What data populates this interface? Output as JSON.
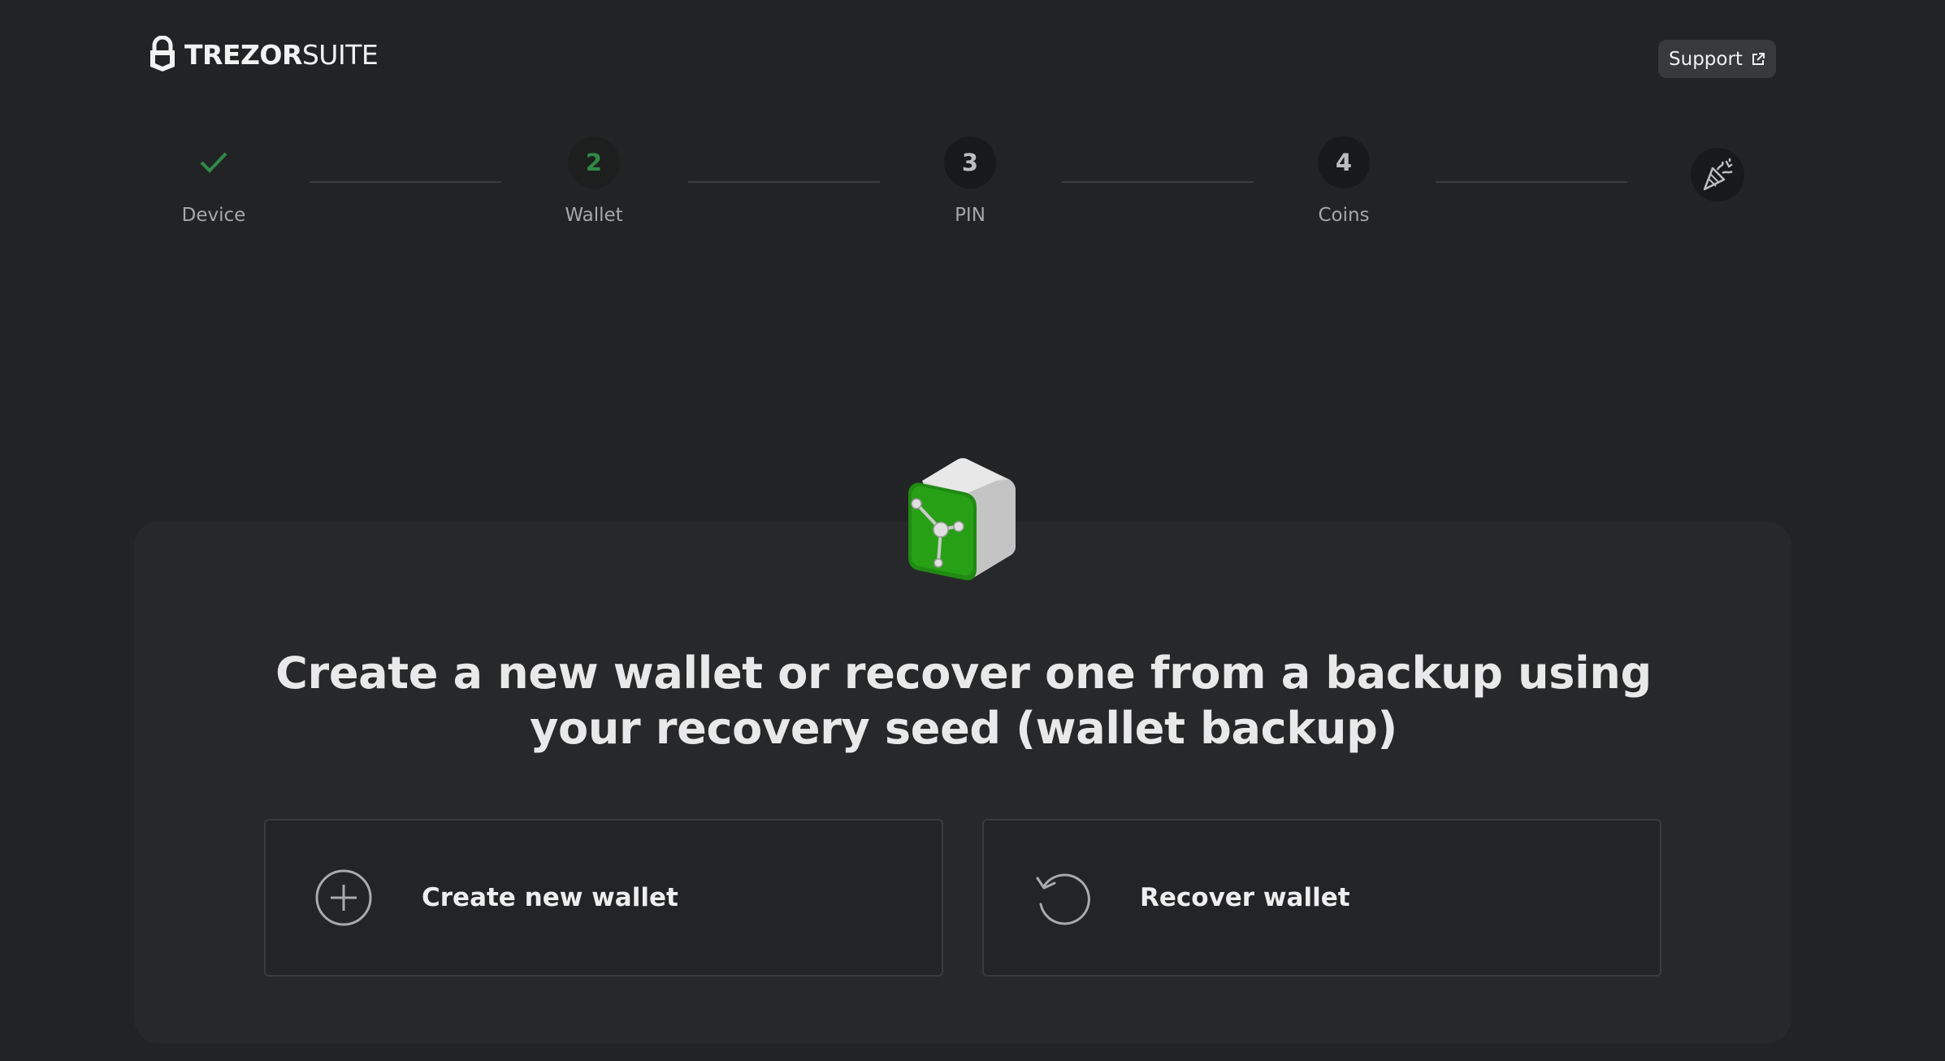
{
  "header": {
    "logo_bold": "TREZOR",
    "logo_light": "SUITE",
    "support_label": "Support"
  },
  "stepper": {
    "steps": [
      {
        "number": "",
        "label": "Device",
        "state": "done"
      },
      {
        "number": "2",
        "label": "Wallet",
        "state": "active"
      },
      {
        "number": "3",
        "label": "PIN",
        "state": "pending"
      },
      {
        "number": "4",
        "label": "Coins",
        "state": "pending"
      }
    ],
    "final_icon": "party-popper-icon"
  },
  "main": {
    "headline": "Create a new wallet or recover one from a backup using your recovery seed (wallet backup)",
    "options": [
      {
        "label": "Create new wallet",
        "icon": "plus-circle-icon"
      },
      {
        "label": "Recover wallet",
        "icon": "undo-icon"
      }
    ]
  },
  "colors": {
    "background": "#222325",
    "card": "#272829",
    "accent_green": "#2f8a45",
    "text": "#e6e6e6"
  }
}
